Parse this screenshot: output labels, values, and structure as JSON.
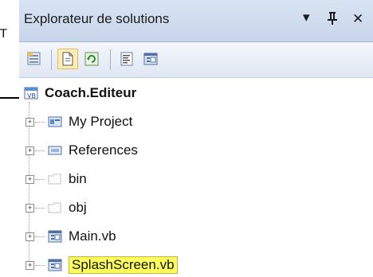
{
  "panel": {
    "title": "Explorateur de solutions",
    "buttons": {
      "dropdown": "▾",
      "pin": "ᛋ",
      "close": "✕"
    }
  },
  "toolbar": {
    "items": [
      {
        "icon": "properties-icon"
      },
      {
        "icon": "show-all-files-icon",
        "pressed": true
      },
      {
        "icon": "refresh-icon"
      },
      {
        "icon": "view-code-icon"
      },
      {
        "icon": "view-designer-icon"
      }
    ]
  },
  "tree": {
    "root": {
      "label": "Coach.Editeur",
      "icon": "vb-project-icon"
    },
    "items": [
      {
        "label": "My Project",
        "icon": "my-project-icon"
      },
      {
        "label": "References",
        "icon": "references-icon"
      },
      {
        "label": "bin",
        "icon": "folder-icon"
      },
      {
        "label": "obj",
        "icon": "folder-icon"
      },
      {
        "label": "Main.vb",
        "icon": "form-file-icon"
      },
      {
        "label": "SplashScreen.vb",
        "icon": "form-file-icon",
        "highlighted": true
      }
    ]
  },
  "background": {
    "fragment": "T"
  }
}
